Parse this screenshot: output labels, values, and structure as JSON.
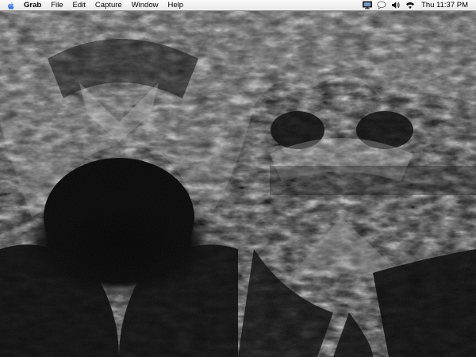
{
  "menubar": {
    "apple_icon": "apple-logo-icon",
    "app_name": "Grab",
    "menus": [
      "File",
      "Edit",
      "Capture",
      "Window",
      "Help"
    ],
    "status_icons": [
      "display-icon",
      "chat-bubble-icon",
      "volume-icon",
      "wifi-icon"
    ],
    "clock": "Thu 11:37 PM"
  },
  "desktop": {
    "picture": "grayscale symmetrical tree-bark face pattern",
    "colors": {
      "dark": "#050505",
      "mid": "#6a6a6a",
      "light": "#e6e6e6"
    }
  }
}
